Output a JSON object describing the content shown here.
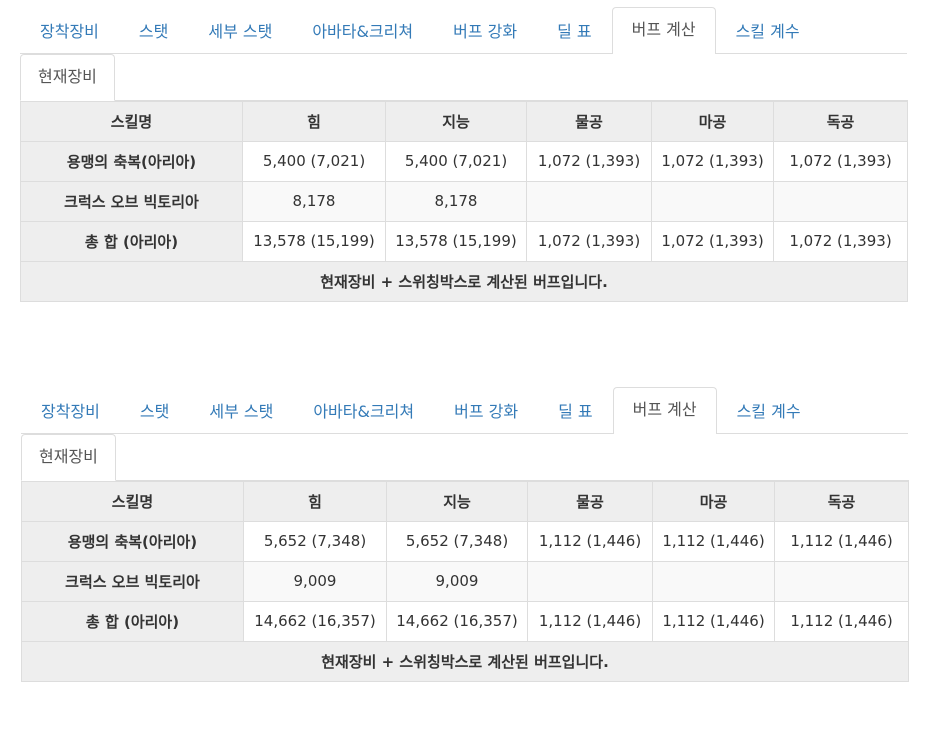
{
  "main_tabs": [
    "장착장비",
    "스탯",
    "세부 스탯",
    "아바타&크리쳐",
    "버프 강화",
    "딜 표",
    "버프 계산",
    "스킬 계수"
  ],
  "sub_tab": "현재장비",
  "table_headers": [
    "스킬명",
    "힘",
    "지능",
    "물공",
    "마공",
    "독공"
  ],
  "panels": [
    {
      "rows": [
        [
          "용맹의 축복(아리아)",
          "5,400 (7,021)",
          "5,400 (7,021)",
          "1,072 (1,393)",
          "1,072 (1,393)",
          "1,072 (1,393)"
        ],
        [
          "크럭스 오브 빅토리아",
          "8,178",
          "8,178",
          "",
          "",
          ""
        ],
        [
          "총 합 (아리아)",
          "13,578 (15,199)",
          "13,578 (15,199)",
          "1,072 (1,393)",
          "1,072 (1,393)",
          "1,072 (1,393)"
        ]
      ],
      "footer": "현재장비 + 스위칭박스로 계산된 버프입니다."
    },
    {
      "rows": [
        [
          "용맹의 축복(아리아)",
          "5,652 (7,348)",
          "5,652 (7,348)",
          "1,112 (1,446)",
          "1,112 (1,446)",
          "1,112 (1,446)"
        ],
        [
          "크럭스 오브 빅토리아",
          "9,009",
          "9,009",
          "",
          "",
          ""
        ],
        [
          "총 합 (아리아)",
          "14,662 (16,357)",
          "14,662 (16,357)",
          "1,112 (1,446)",
          "1,112 (1,446)",
          "1,112 (1,446)"
        ]
      ],
      "footer": "현재장비 + 스위칭박스로 계산된 버프입니다."
    }
  ]
}
